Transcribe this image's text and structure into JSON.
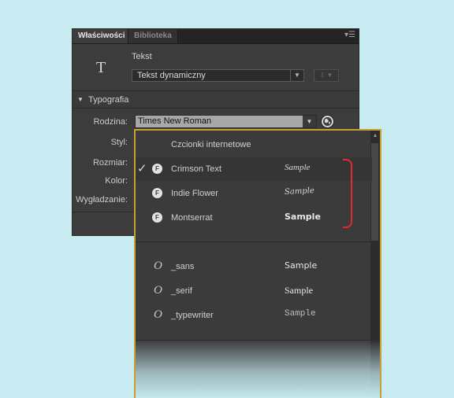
{
  "panel": {
    "tabs": [
      {
        "label": "Właściwości",
        "active": true
      },
      {
        "label": "Biblioteka",
        "active": false
      }
    ],
    "menu_icon": "panel-menu-icon",
    "type_icon": "T",
    "text_label": "Tekst",
    "text_type": "Tekst dynamiczny",
    "section": "Typografia",
    "labels": {
      "family": "Rodzina:",
      "style": "Styl:",
      "size": "Rozmiar:",
      "color": "Kolor:",
      "smoothing": "Wygładzanie:"
    },
    "font_family": "Times New Roman"
  },
  "font_list": {
    "title": "Czcionki internetowe",
    "web_fonts": [
      {
        "name": "Crimson Text",
        "sample": "Sample",
        "checked": true,
        "style": "crimson"
      },
      {
        "name": "Indie Flower",
        "sample": "Sample",
        "checked": false,
        "style": "indie"
      },
      {
        "name": "Montserrat",
        "sample": "Sample",
        "checked": false,
        "style": "montserrat"
      }
    ],
    "device_fonts": [
      {
        "name": "_sans",
        "sample": "Sample",
        "style": "sans"
      },
      {
        "name": "_serif",
        "sample": "Sample",
        "style": "serif"
      },
      {
        "name": "_typewriter",
        "sample": "Sample",
        "style": "tw"
      }
    ],
    "checkmark": "✓",
    "web_font_icon": "F",
    "device_font_icon": "O"
  },
  "colors": {
    "background": "#c7ebf0",
    "panel": "#3c3c3c",
    "popup_border": "#c8a030",
    "bracket": "#e32b2b"
  }
}
